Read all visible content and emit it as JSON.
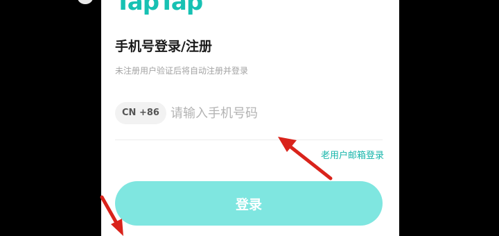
{
  "app": {
    "logo_text": "TapTap",
    "brand_color": "#17c1b3"
  },
  "login_form": {
    "title": "手机号登录/注册",
    "subtitle": "未注册用户验证后将自动注册并登录",
    "country_code": "CN +86",
    "phone_placeholder": "请输入手机号码",
    "phone_value": "",
    "email_login_link": "老用户邮箱登录",
    "submit_label": "登录",
    "submit_color": "#7fe6e0"
  },
  "annotations": {
    "arrow_color": "#d9231b",
    "arrow_icons": [
      "arrow-to-email-link-icon",
      "arrow-to-login-button-icon"
    ]
  }
}
